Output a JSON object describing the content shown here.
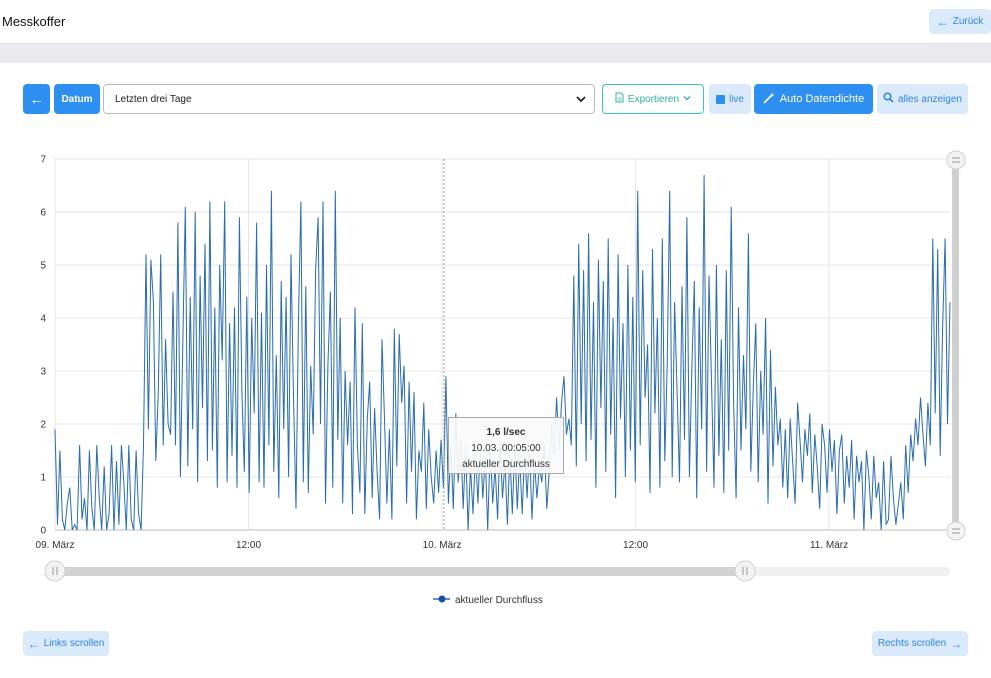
{
  "header": {
    "title": "Messkoffer",
    "back_label": "Zurück"
  },
  "toolbar": {
    "date_label": "Datum",
    "range_value": "Letzten drei Tage",
    "export_label": "Exportieren",
    "live_label": "live",
    "auto_label": "Auto Datendichte",
    "show_all_label": "alles anzeigen"
  },
  "chart_data": {
    "type": "line",
    "x_ticks": [
      "09. März",
      "12:00",
      "10. März",
      "12:00",
      "11. März"
    ],
    "y_ticks": [
      "0",
      "1",
      "2",
      "3",
      "4",
      "5",
      "6",
      "7"
    ],
    "ylim": [
      0,
      7
    ],
    "series": [
      {
        "name": "aktueller Durchfluss",
        "color": "#2a6cad",
        "values": [
          1.9,
          0.1,
          1.5,
          0.2,
          0,
          0.5,
          0.8,
          0,
          0.1,
          0,
          1.6,
          0.2,
          0.6,
          0,
          1.5,
          0.4,
          0,
          1.6,
          0.6,
          0,
          1.2,
          0,
          0.3,
          1.6,
          0,
          1.3,
          0.1,
          1.6,
          0.9,
          0,
          1.6,
          0.2,
          0,
          1.5,
          0.3,
          0,
          1.6,
          5.2,
          1.9,
          5.1,
          4.3,
          1.3,
          2.6,
          5.2,
          1.6,
          3.6,
          2.0,
          1.8,
          4.5,
          1.6,
          5.8,
          1.0,
          3.6,
          6.1,
          1.2,
          4.4,
          1.9,
          6.0,
          0.9,
          4.8,
          2.3,
          5.4,
          1.3,
          6.2,
          1.5,
          4.2,
          0.8,
          5.0,
          3.2,
          6.2,
          0.9,
          3.9,
          1.4,
          4.2,
          0.8,
          5.9,
          2.6,
          1.1,
          4.4,
          0.7,
          4.0,
          2.2,
          5.8,
          0.9,
          4.1,
          0.8,
          5.0,
          1.6,
          6.4,
          1.1,
          3.3,
          0.6,
          4.7,
          1.9,
          4.4,
          1.0,
          5.2,
          2.5,
          0.4,
          3.9,
          6.2,
          0.9,
          4.6,
          0.7,
          3.1,
          1.8,
          4.9,
          5.9,
          2.0,
          6.2,
          0.5,
          3.1,
          4.5,
          0.8,
          6.4,
          1.7,
          4.0,
          0.5,
          3.0,
          1.6,
          2.8,
          0.3,
          4.2,
          1.6,
          0.7,
          3.9,
          0.3,
          2.1,
          2.8,
          0.6,
          2.3,
          1.1,
          0.2,
          3.6,
          2.1,
          0.5,
          1.9,
          0.2,
          3.8,
          1.2,
          3.7,
          2.4,
          3.1,
          0.5,
          2.8,
          1.1,
          2.6,
          0.2,
          1.5,
          1.1,
          2.4,
          0.4,
          1.9,
          1.0,
          0.5,
          1.5,
          0.7,
          1.7,
          0.8,
          2.9,
          0.5,
          1.6,
          0.4,
          2.2,
          0.9,
          1.7,
          0.4,
          1.6,
          0,
          1.2,
          0.3,
          1.5,
          0.5,
          1.6,
          0.6,
          1.4,
          0,
          1.6,
          0.5,
          1.2,
          0.2,
          1.7,
          0.6,
          1.3,
          0.1,
          1.5,
          0.3,
          1.6,
          0.4,
          1.4,
          0.3,
          1.5,
          0.6,
          1.6,
          0.2,
          1.3,
          0.6,
          1.2,
          0.9,
          1.6,
          0.4,
          1.1,
          2.0,
          1.4,
          2.5,
          1.5,
          2.4,
          2.9,
          1.8,
          2.1,
          1.6,
          4.8,
          1.2,
          5.4,
          2.0,
          4.9,
          1.3,
          5.6,
          1.7,
          4.3,
          0.8,
          5.1,
          2.3,
          4.7,
          1.1,
          5.5,
          1.8,
          4.0,
          0.6,
          5.2,
          2.1,
          3.9,
          1.0,
          5.0,
          1.5,
          4.4,
          0.9,
          6.4,
          1.6,
          4.9,
          2.5,
          3.5,
          0.7,
          5.3,
          2.2,
          4.0,
          0.8,
          5.5,
          1.3,
          3.1,
          6.4,
          1.0,
          4.3,
          2.6,
          0.9,
          4.6,
          1.7,
          5.9,
          1.0,
          3.0,
          4.7,
          0.6,
          4.2,
          1.9,
          6.7,
          1.1,
          4.8,
          2.8,
          0.8,
          5.0,
          1.4,
          3.6,
          0.7,
          4.9,
          1.5,
          6.1,
          2.4,
          0.6,
          4.2,
          1.5,
          3.3,
          1.9,
          5.6,
          1.1,
          2.7,
          3.9,
          0.9,
          3.0,
          1.8,
          4.0,
          0.5,
          3.4,
          1.2,
          2.7,
          1.6,
          2.1,
          0.8,
          1.9,
          0.6,
          2.1,
          1.3,
          0.5,
          2.4,
          1.7,
          0.9,
          1.9,
          1.4,
          2.2,
          0.7,
          1.8,
          1.2,
          0.4,
          2.0,
          1.6,
          0.7,
          1.9,
          1.1,
          1.7,
          0.3,
          1.5,
          1.8,
          0.5,
          1.4,
          0.8,
          1.7,
          0.2,
          1.4,
          0.9,
          1.3,
          0,
          1.5,
          1.0,
          0.2,
          1.4,
          0.6,
          0.9,
          0,
          1.3,
          0.1,
          0.2,
          1.4,
          0.6,
          0.1,
          0.5,
          0.9,
          0.2,
          1.6,
          0.7,
          1.8,
          1.3,
          2.1,
          1.6,
          2.5,
          1.8,
          1.2,
          2.4,
          1.6,
          5.5,
          2.2,
          5.3,
          1.4,
          3.8,
          5.5,
          2.0,
          4.3
        ]
      }
    ]
  },
  "tooltip": {
    "value": "1,6 l/sec",
    "time": "10.03. 00:05:00",
    "series": "aktueller Durchfluss"
  },
  "footer": {
    "left_label": "Links scrollen",
    "right_label": "Rechts scrollen"
  }
}
